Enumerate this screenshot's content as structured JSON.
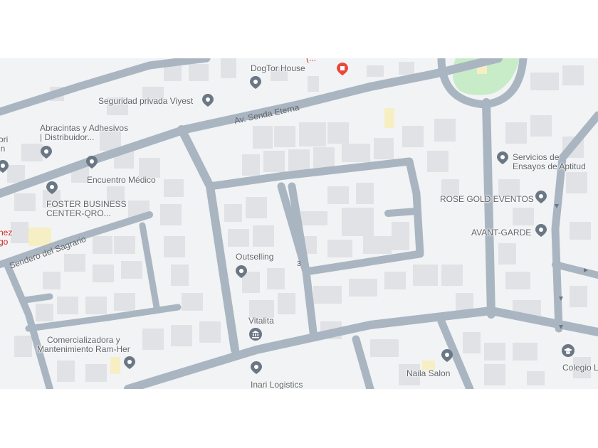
{
  "map": {
    "colors": {
      "background": "#f1f3f4",
      "road": "#aab5c2",
      "building": "#e0e2e5",
      "park": "#c8ebc8",
      "poi_pin": "#6b7785",
      "edu_pin": "#6b7785",
      "red_pin": "#e9483c"
    },
    "streets": {
      "senda_eterna": "Av. Senda Eterna",
      "sagrario": "Sendero del Sagrario",
      "small_number": "3"
    },
    "places": [
      {
        "id": "partial-top",
        "label": "(...",
        "icon": "partial-label"
      },
      {
        "id": "dogtor",
        "label": "DogTor House",
        "icon": "pin-icon"
      },
      {
        "id": "red-place",
        "label": "",
        "icon": "red-pin-icon"
      },
      {
        "id": "seguridad",
        "label": "Seguridad privada Viyest",
        "icon": "pin-icon"
      },
      {
        "id": "abracintas",
        "label": "Abracintas y Adhesivos\n| Distribuidor...",
        "icon": "pin-icon"
      },
      {
        "id": "encuentro",
        "label": "Encuentro Médico",
        "icon": "pin-icon"
      },
      {
        "id": "foster",
        "label": "FOSTER BUSINESS\nCENTER-QRO...",
        "icon": "pin-icon"
      },
      {
        "id": "outselling",
        "label": "Outselling",
        "icon": "pin-icon"
      },
      {
        "id": "vitalita",
        "label": "Vitalita",
        "icon": "bank-icon"
      },
      {
        "id": "comercializadora",
        "label": "Comercializadora y\nMantenimiento Ram-Her",
        "icon": "pin-icon"
      },
      {
        "id": "inari",
        "label": "Inari Logistics",
        "icon": "pin-icon"
      },
      {
        "id": "naila",
        "label": "Naila Salon",
        "icon": "pin-icon"
      },
      {
        "id": "servicios",
        "label": "Servicios de\nEnsayos de Aptitud",
        "icon": "pin-icon"
      },
      {
        "id": "rosegold",
        "label": "ROSE GOLD EVENTOS",
        "icon": "pin-icon"
      },
      {
        "id": "avantgarde",
        "label": "AVANT-GARDE",
        "icon": "pin-icon"
      },
      {
        "id": "colegio",
        "label": "Colegio L",
        "icon": "school-icon"
      },
      {
        "id": "left-edge-1",
        "label": "ori\nin",
        "icon": "pin-icon"
      },
      {
        "id": "left-edge-2",
        "label": "nez\ngo",
        "icon": "none"
      }
    ]
  }
}
